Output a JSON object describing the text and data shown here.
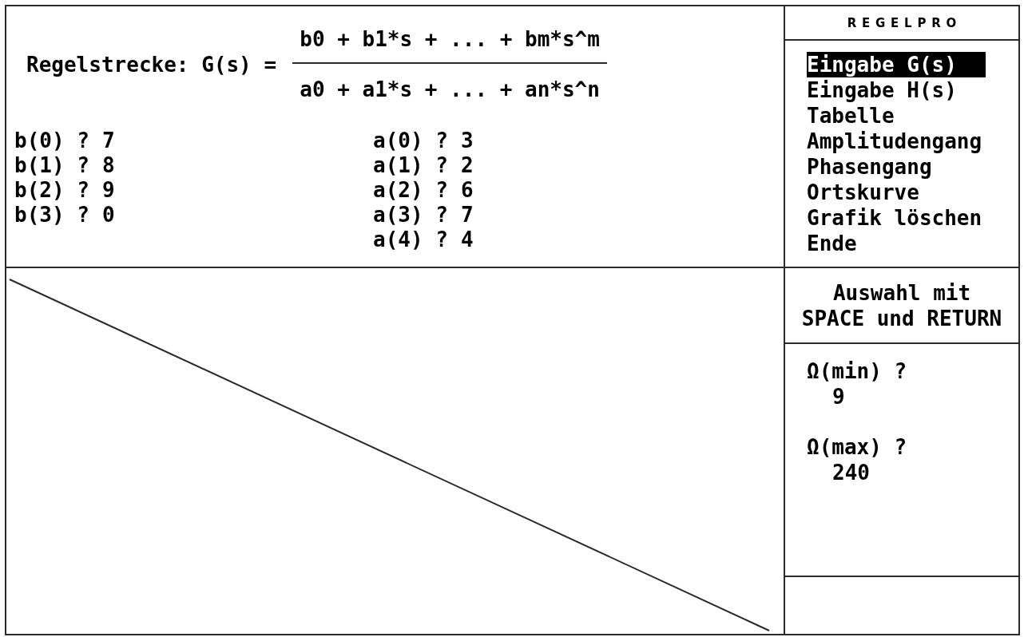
{
  "app_title": "REGELPRO",
  "transfer_function": {
    "label": "Regelstrecke: G(s) =",
    "numerator": "b0 + b1*s + ... + bm*s^m",
    "denominator": "a0 + a1*s + ... + an*s^n"
  },
  "numerator_coefficients": [
    {
      "prompt": "b(0) ?",
      "value": "7"
    },
    {
      "prompt": "b(1) ?",
      "value": "8"
    },
    {
      "prompt": "b(2) ?",
      "value": "9"
    },
    {
      "prompt": "b(3) ?",
      "value": "0"
    }
  ],
  "denominator_coefficients": [
    {
      "prompt": "a(0) ?",
      "value": "3"
    },
    {
      "prompt": "a(1) ?",
      "value": "2"
    },
    {
      "prompt": "a(2) ?",
      "value": "6"
    },
    {
      "prompt": "a(3) ?",
      "value": "7"
    },
    {
      "prompt": "a(4) ?",
      "value": "4"
    }
  ],
  "menu": [
    {
      "label": "Eingabe G(s)",
      "selected": true
    },
    {
      "label": "Eingabe H(s)",
      "selected": false
    },
    {
      "label": "Tabelle",
      "selected": false
    },
    {
      "label": "Amplitudengang",
      "selected": false
    },
    {
      "label": "Phasengang",
      "selected": false
    },
    {
      "label": "Ortskurve",
      "selected": false
    },
    {
      "label": "Grafik löschen",
      "selected": false
    },
    {
      "label": "Ende",
      "selected": false
    }
  ],
  "hint": "Auswahl mit SPACE und RETURN",
  "frequency_inputs": [
    {
      "prompt": "Ω(min) ?",
      "value": "9"
    },
    {
      "prompt": "Ω(max) ?",
      "value": "240"
    }
  ]
}
